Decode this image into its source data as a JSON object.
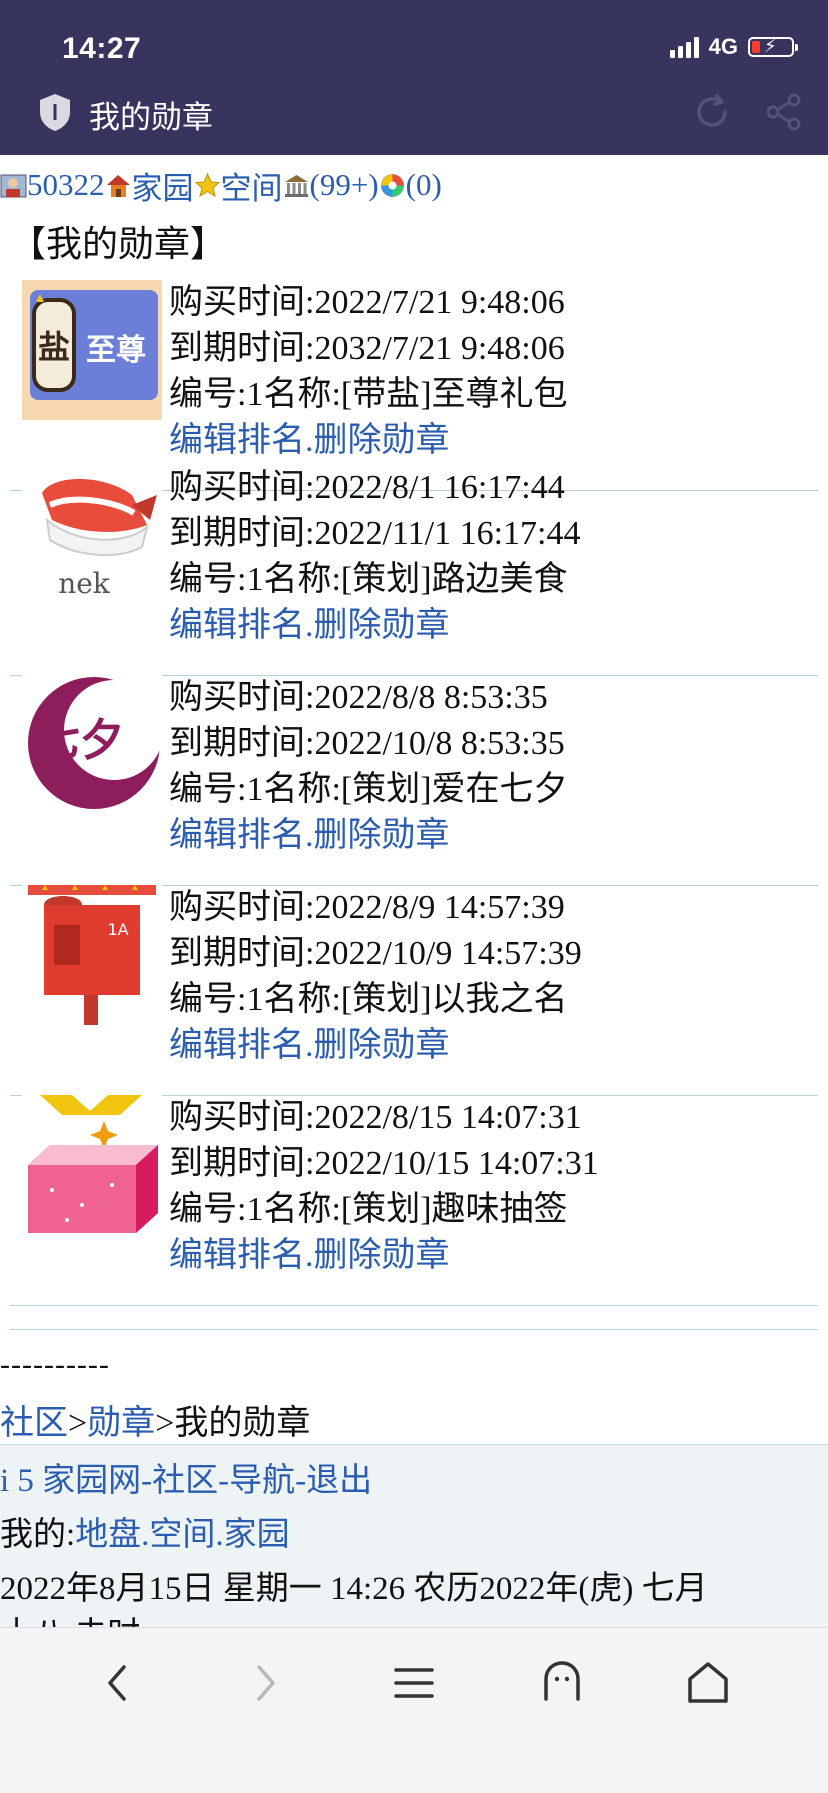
{
  "status": {
    "time": "14:27",
    "network": "4G"
  },
  "header": {
    "title": "我的勋章"
  },
  "topnav": {
    "user_id": "50322",
    "home": "家园",
    "space": "空间",
    "bank": "(99+)",
    "msg": "(0)"
  },
  "page": {
    "heading": "【我的勋章】"
  },
  "medals": [
    {
      "buy": "购买时间:2022/7/21 9:48:06",
      "expire": "到期时间:2032/7/21 9:48:06",
      "name": "编号:1名称:[带盐]至尊礼包",
      "edit": "编辑排名",
      "dot": ".",
      "delete": "删除勋章",
      "icon": "salt-supreme-badge-icon",
      "badge_text_a": "盐",
      "badge_text_b": "至尊"
    },
    {
      "buy": "购买时间:2022/8/1 16:17:44",
      "expire": "到期时间:2022/11/1 16:17:44",
      "name": "编号:1名称:[策划]路边美食",
      "edit": "编辑排名",
      "dot": ".",
      "delete": "删除勋章",
      "icon": "sushi-badge-icon",
      "badge_text_a": "nek"
    },
    {
      "buy": "购买时间:2022/8/8 8:53:35",
      "expire": "到期时间:2022/10/8 8:53:35",
      "name": "编号:1名称:[策划]爱在七夕",
      "edit": "编辑排名",
      "dot": ".",
      "delete": "删除勋章",
      "icon": "qixi-moon-badge-icon",
      "badge_text_a": "七夕"
    },
    {
      "buy": "购买时间:2022/8/9 14:57:39",
      "expire": "到期时间:2022/10/9 14:57:39",
      "name": "编号:1名称:[策划]以我之名",
      "edit": "编辑排名",
      "dot": ".",
      "delete": "删除勋章",
      "icon": "mailbox-badge-icon",
      "badge_text_a": "1A"
    },
    {
      "buy": "购买时间:2022/8/15 14:07:31",
      "expire": "到期时间:2022/10/15 14:07:31",
      "name": "编号:1名称:[策划]趣味抽签",
      "edit": "编辑排名",
      "dot": ".",
      "delete": "删除勋章",
      "icon": "lottery-box-badge-icon"
    }
  ],
  "dashes": "----------",
  "breadcrumb": {
    "community": "社区",
    "gt1": ">",
    "medals": "勋章",
    "gt2": ">",
    "current": "我的勋章"
  },
  "footer": {
    "site": "i 5 家园网",
    "dash1": "-",
    "community": "社区",
    "dash2": "-",
    "nav": "导航",
    "dash3": "-",
    "logout": "退出",
    "mine_label": "我的:",
    "land": "地盘",
    "d1": ".",
    "space": "空间",
    "d2": ".",
    "home": "家园",
    "date_line": "2022年8月15日  星期一  14:26  农历2022年(虎)  七月",
    "date_line2": "十八  未时"
  },
  "colors": {
    "header_bg": "#37345e",
    "link": "#2a5db0",
    "divider": "#b8d4c8",
    "footer_bg": "#eef4f5"
  }
}
